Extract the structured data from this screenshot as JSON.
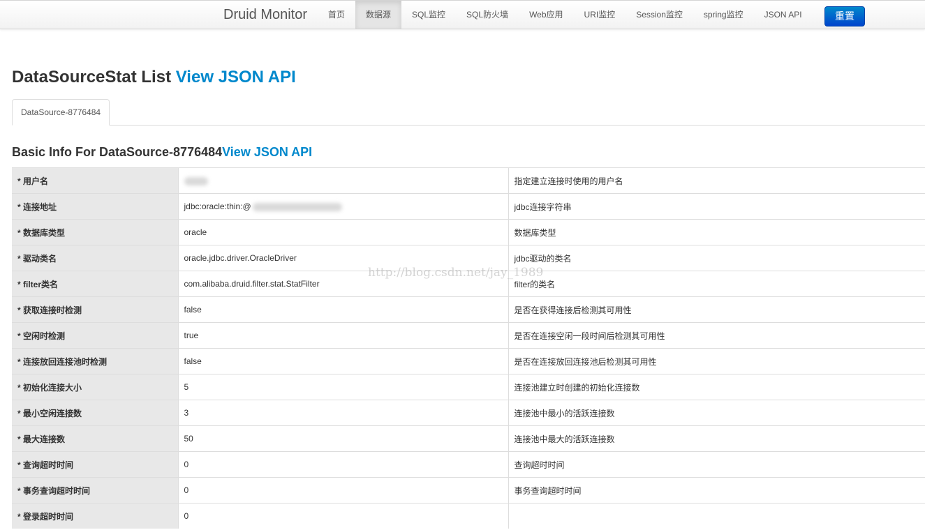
{
  "navbar": {
    "brand": "Druid Monitor",
    "items": [
      {
        "label": "首页",
        "active": false
      },
      {
        "label": "数据源",
        "active": true
      },
      {
        "label": "SQL监控",
        "active": false
      },
      {
        "label": "SQL防火墙",
        "active": false
      },
      {
        "label": "Web应用",
        "active": false
      },
      {
        "label": "URI监控",
        "active": false
      },
      {
        "label": "Session监控",
        "active": false
      },
      {
        "label": "spring监控",
        "active": false
      },
      {
        "label": "JSON API",
        "active": false
      }
    ],
    "reset_label": "重置"
  },
  "page": {
    "title": "DataSourceStat List",
    "title_link": "View JSON API"
  },
  "tabs": [
    {
      "label": "DataSource-8776484",
      "active": true
    }
  ],
  "basic_info": {
    "title": "Basic Info For DataSource-8776484",
    "title_link": "View JSON API",
    "rows": [
      {
        "label": "* 用户名",
        "value": "",
        "desc": "指定建立连接时使用的用户名"
      },
      {
        "label": "* 连接地址",
        "value": "jdbc:oracle:thin:@",
        "desc": "jdbc连接字符串"
      },
      {
        "label": "* 数据库类型",
        "value": "oracle",
        "desc": "数据库类型"
      },
      {
        "label": "* 驱动类名",
        "value": "oracle.jdbc.driver.OracleDriver",
        "desc": "jdbc驱动的类名"
      },
      {
        "label": "* filter类名",
        "value": "com.alibaba.druid.filter.stat.StatFilter",
        "desc": "filter的类名"
      },
      {
        "label": "* 获取连接时检测",
        "value": "false",
        "desc": "是否在获得连接后检测其可用性"
      },
      {
        "label": "* 空闲时检测",
        "value": "true",
        "desc": "是否在连接空闲一段时间后检测其可用性"
      },
      {
        "label": "* 连接放回连接池时检测",
        "value": "false",
        "desc": "是否在连接放回连接池后检测其可用性"
      },
      {
        "label": "* 初始化连接大小",
        "value": "5",
        "desc": "连接池建立时创建的初始化连接数"
      },
      {
        "label": "* 最小空闲连接数",
        "value": "3",
        "desc": "连接池中最小的活跃连接数"
      },
      {
        "label": "* 最大连接数",
        "value": "50",
        "desc": "连接池中最大的活跃连接数"
      },
      {
        "label": "* 查询超时时间",
        "value": "0",
        "desc": "查询超时时间"
      },
      {
        "label": "* 事务查询超时时间",
        "value": "0",
        "desc": "事务查询超时时间"
      },
      {
        "label": "* 登录超时时间",
        "value": "0",
        "desc": ""
      }
    ]
  },
  "watermark": "http://blog.csdn.net/jay_1989"
}
